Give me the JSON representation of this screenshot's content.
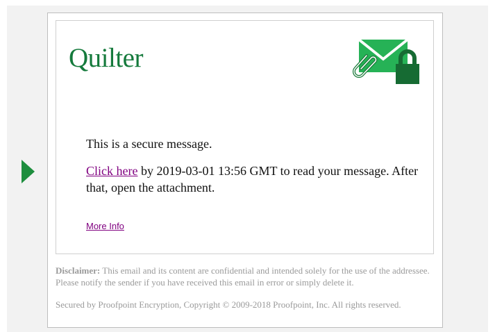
{
  "brand": {
    "name": "Quilter",
    "color": "#157a3c"
  },
  "icons": {
    "arrow": "green-arrow-icon",
    "secure_mail": "secure-envelope-lock-icon"
  },
  "message": {
    "line1": "This is a secure message.",
    "link_label": "Click here",
    "line2_rest": " by 2019-03-01 13:56 GMT to read your message. After that, open the attachment.",
    "more_info": "More Info"
  },
  "footer": {
    "disclaimer_label": "Disclaimer:",
    "disclaimer_text": " This email and its content are confidential and intended solely for the use of the addressee. Please notify the sender if you have received this email in error or simply delete it.",
    "copyright": "Secured by Proofpoint Encryption, Copyright © 2009-2018 Proofpoint, Inc. All rights reserved."
  },
  "colors": {
    "link": "#800080",
    "accent_green": "#1e8e3e",
    "muted_text": "#9a9a9a"
  }
}
